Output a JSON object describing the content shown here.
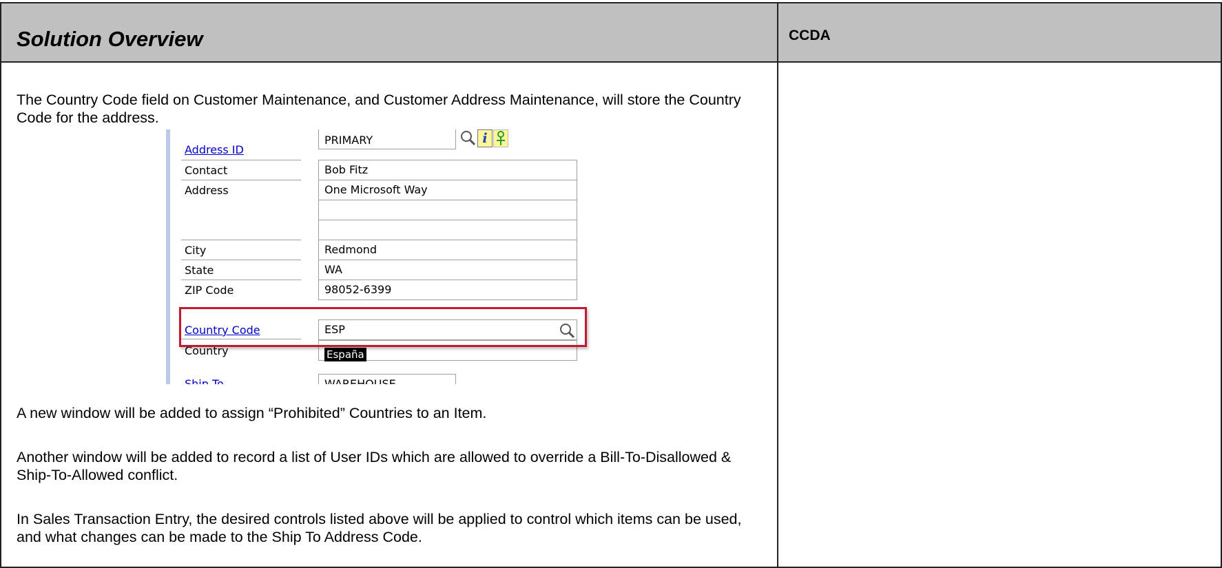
{
  "header": {
    "title": "Solution Overview",
    "side_title": "CCDA"
  },
  "body": {
    "paragraph_1": "The Country Code field on Customer Maintenance, and Customer Address Maintenance, will store the Country Code for the address.",
    "paragraph_2": "A new window will be added to assign “Prohibited” Countries to an Item.",
    "paragraph_3": "Another window will be added to record a list of User IDs which are allowed to override a Bill-To-Disallowed & Ship-To-Allowed conflict.",
    "paragraph_4": "In Sales Transaction Entry, the desired controls listed above will be applied to control which items can be used, and what changes can be made to the Ship To Address Code."
  },
  "screenshot": {
    "rows": [
      {
        "label": "Address ID",
        "value": "PRIMARY"
      },
      {
        "label": "Contact",
        "value": "Bob Fitz"
      },
      {
        "label": "Address",
        "value": "One Microsoft Way"
      },
      {
        "label": "City",
        "value": "Redmond"
      },
      {
        "label": "State",
        "value": "WA"
      },
      {
        "label": "ZIP Code",
        "value": "98052-6399"
      },
      {
        "label": "Country Code",
        "value": "ESP"
      },
      {
        "label": "Country",
        "value": "España"
      },
      {
        "label": "Ship To",
        "value": "WAREHOUSE"
      }
    ],
    "info_icon_glyph": "i",
    "highlight_color": "#c8162d"
  }
}
